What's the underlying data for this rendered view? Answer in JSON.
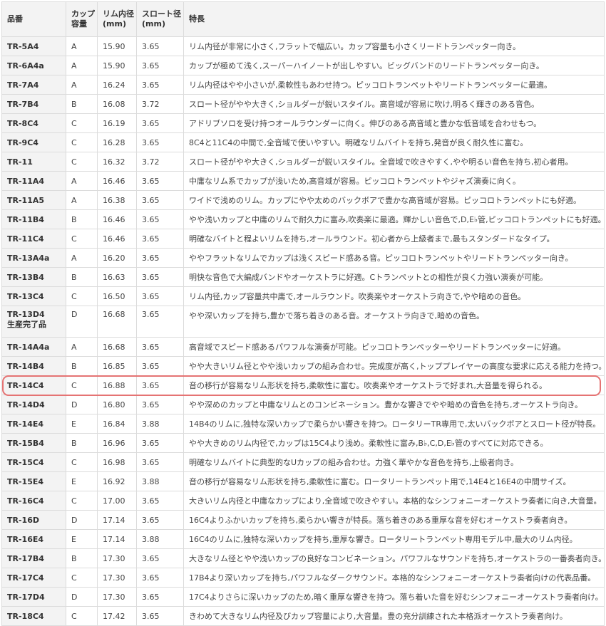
{
  "header": {
    "model": "品番",
    "cup": "カップ\n容量",
    "rim": "リム内径\n(mm)",
    "throat": "スロート径\n(mm)",
    "feature": "特長"
  },
  "highlight_color": "#e57373",
  "rows": [
    {
      "model": "TR-5A4",
      "cup": "A",
      "rim": "15.90",
      "throat": "3.65",
      "feature": "リム内径が非常に小さく,フラットで幅広い。カップ容量も小さくリードトランペッター向き。"
    },
    {
      "model": "TR-6A4a",
      "cup": "A",
      "rim": "15.90",
      "throat": "3.65",
      "feature": "カップが極めて浅く,スーパーハイノートが出しやすい。ビッグバンドのリードトランペッター向き。"
    },
    {
      "model": "TR-7A4",
      "cup": "A",
      "rim": "16.24",
      "throat": "3.65",
      "feature": "リム内径はやや小さいが,柔軟性もあわせ持つ。ピッコロトランペットやリードトランペッターに最適。"
    },
    {
      "model": "TR-7B4",
      "cup": "B",
      "rim": "16.08",
      "throat": "3.72",
      "feature": "スロート径がやや大きく,ショルダーが鋭いスタイル。高音域が容易に吹け,明るく輝きのある音色。"
    },
    {
      "model": "TR-8C4",
      "cup": "C",
      "rim": "16.19",
      "throat": "3.65",
      "feature": "アドリブソロを受け持つオールラウンダーに向く。伸びのある高音域と豊かな低音域を合わせもつ。"
    },
    {
      "model": "TR-9C4",
      "cup": "C",
      "rim": "16.28",
      "throat": "3.65",
      "feature": "8C4と11C4の中間で,全音域で使いやすい。明確なリムバイトを持ち,発音が良く耐久性に富む。"
    },
    {
      "model": "TR-11",
      "cup": "C",
      "rim": "16.32",
      "throat": "3.72",
      "feature": "スロート径がやや大きく,ショルダーが鋭いスタイル。全音域で吹きやすく,やや明るい音色を持ち,初心者用。"
    },
    {
      "model": "TR-11A4",
      "cup": "A",
      "rim": "16.46",
      "throat": "3.65",
      "feature": "中庸なリム系でカップが浅いため,高音域が容易。ピッコロトランペットやジャズ演奏に向く。"
    },
    {
      "model": "TR-11A5",
      "cup": "A",
      "rim": "16.38",
      "throat": "3.65",
      "feature": "ワイドで浅めのリム。カップにやや太めのバックボアで豊かな高音域が容易。ピッコロトランペットにも好適。"
    },
    {
      "model": "TR-11B4",
      "cup": "B",
      "rim": "16.46",
      "throat": "3.65",
      "feature": "やや浅いカップと中庸のリムで耐久力に富み,吹奏楽に最適。輝かしい音色で,D,E♭管,ピッコロトランペットにも好適。"
    },
    {
      "model": "TR-11C4",
      "cup": "C",
      "rim": "16.46",
      "throat": "3.65",
      "feature": "明確なバイトと程よいリムを持ち,オールラウンド。初心者から上級者まで,最もスタンダードなタイプ。"
    },
    {
      "model": "TR-13A4a",
      "cup": "A",
      "rim": "16.20",
      "throat": "3.65",
      "feature": "ややフラットなリムでカップは浅くスピード感ある音。ピッコロトランペットやリードトランペッター向き。"
    },
    {
      "model": "TR-13B4",
      "cup": "B",
      "rim": "16.63",
      "throat": "3.65",
      "feature": "明快な音色で大編成バンドやオーケストラに好適。Cトランペットとの相性が良く力強い演奏が可能。"
    },
    {
      "model": "TR-13C4",
      "cup": "C",
      "rim": "16.50",
      "throat": "3.65",
      "feature": "リム内径,カップ容量共中庸で,オールラウンド。吹奏楽やオーケストラ向きで,やや暗めの音色。"
    },
    {
      "model": "TR-13D4",
      "model2": "生産完了品",
      "cup": "D",
      "rim": "16.68",
      "throat": "3.65",
      "feature": "やや深いカップを持ち,豊かで落ち着きのある音。オーケストラ向きで,暗めの音色。"
    },
    {
      "model": "TR-14A4a",
      "cup": "A",
      "rim": "16.68",
      "throat": "3.65",
      "feature": "高音域でスピード感あるパワフルな演奏が可能。ピッコロトランペッターやリードトランペッターに好適。"
    },
    {
      "model": "TR-14B4",
      "cup": "B",
      "rim": "16.85",
      "throat": "3.65",
      "feature": "やや大きいリム径とやや浅いカップの組み合わせ。完成度が高く,トッププレイヤーの高度な要求に応える能力を持つ。"
    },
    {
      "model": "TR-14C4",
      "cup": "C",
      "rim": "16.88",
      "throat": "3.65",
      "feature": "音の移行が容易なリム形状を持ち,柔軟性に富む。吹奏楽やオーケストラで好まれ,大音量を得られる。"
    },
    {
      "model": "TR-14D4",
      "cup": "D",
      "rim": "16.80",
      "throat": "3.65",
      "feature": "やや深めのカップと中庸なリムとのコンビネーション。豊かな響きでやや暗めの音色を持ち,オーケストラ向き。"
    },
    {
      "model": "TR-14E4",
      "cup": "E",
      "rim": "16.84",
      "throat": "3.88",
      "feature": "14B4のリムに,独特な深いカップで柔らかい響きを持つ。ロータリーTR専用で,太いバックボアとスロート径が特長。"
    },
    {
      "model": "TR-15B4",
      "cup": "B",
      "rim": "16.96",
      "throat": "3.65",
      "feature": "やや大きめのリム内径で,カップは15C4より浅め。柔軟性に富み,B♭,C,D,E♭管のすべてに対応できる。"
    },
    {
      "model": "TR-15C4",
      "cup": "C",
      "rim": "16.98",
      "throat": "3.65",
      "feature": "明確なリムバイトに典型的なUカップの組み合わせ。力強く華やかな音色を持ち,上級者向き。"
    },
    {
      "model": "TR-15E4",
      "cup": "E",
      "rim": "16.92",
      "throat": "3.88",
      "feature": "音の移行が容易なリム形状を持ち,柔軟性に富む。ロータリートランペット用で,14E4と16E4の中間サイズ。"
    },
    {
      "model": "TR-16C4",
      "cup": "C",
      "rim": "17.00",
      "throat": "3.65",
      "feature": "大きいリム内径と中庸なカップにより,全音域で吹きやすい。本格的なシンフォニーオーケストラ奏者に向き,大音量。"
    },
    {
      "model": "TR-16D",
      "cup": "D",
      "rim": "17.14",
      "throat": "3.65",
      "feature": "16C4よりふかいカップを持ち,柔らかい響きが特長。落ち着きのある重厚な音を好むオーケストラ奏者向き。"
    },
    {
      "model": "TR-16E4",
      "cup": "E",
      "rim": "17.14",
      "throat": "3.88",
      "feature": "16C4のリムに,独特な深いカップを持ち,重厚な響き。ロータリートランペット専用モデル中,最大のリム内径。"
    },
    {
      "model": "TR-17B4",
      "cup": "B",
      "rim": "17.30",
      "throat": "3.65",
      "feature": "大きなリム径とやや浅いカップの良好なコンビネーション。パワフルなサウンドを持ち,オーケストラの一番奏者向き。"
    },
    {
      "model": "TR-17C4",
      "cup": "C",
      "rim": "17.30",
      "throat": "3.65",
      "feature": "17B4より深いカップを持ち,パワフルなダークサウンド。本格的なシンフォニーオーケストラ奏者向けの代表品番。"
    },
    {
      "model": "TR-17D4",
      "cup": "D",
      "rim": "17.30",
      "throat": "3.65",
      "feature": "17C4よりさらに深いカップのため,暗く重厚な響きを持つ。落ち着いた音を好むシンフォニーオーケストラ奏者向け。"
    },
    {
      "model": "TR-18C4",
      "cup": "C",
      "rim": "17.42",
      "throat": "3.65",
      "feature": "きわめて大きなリム内径及びカップ容量により,大音量。豊の充分訓練された本格派オーケストラ奏者向け。"
    }
  ]
}
